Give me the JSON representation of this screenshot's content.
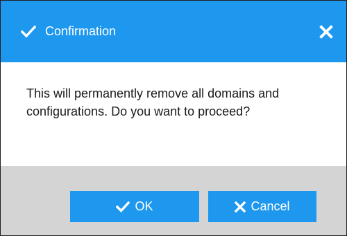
{
  "dialog": {
    "title": "Confirmation",
    "title_icon": "checkmark-icon",
    "close_icon": "close-icon",
    "message": "This will permanently remove all domains and configurations. Do you want to proceed?",
    "buttons": {
      "ok": {
        "label": "OK",
        "icon": "checkmark-icon"
      },
      "cancel": {
        "label": "Cancel",
        "icon": "close-icon"
      }
    }
  },
  "colors": {
    "accent": "#1e98ef",
    "footer": "#d4d4d4",
    "text": "#1a1a1a"
  }
}
